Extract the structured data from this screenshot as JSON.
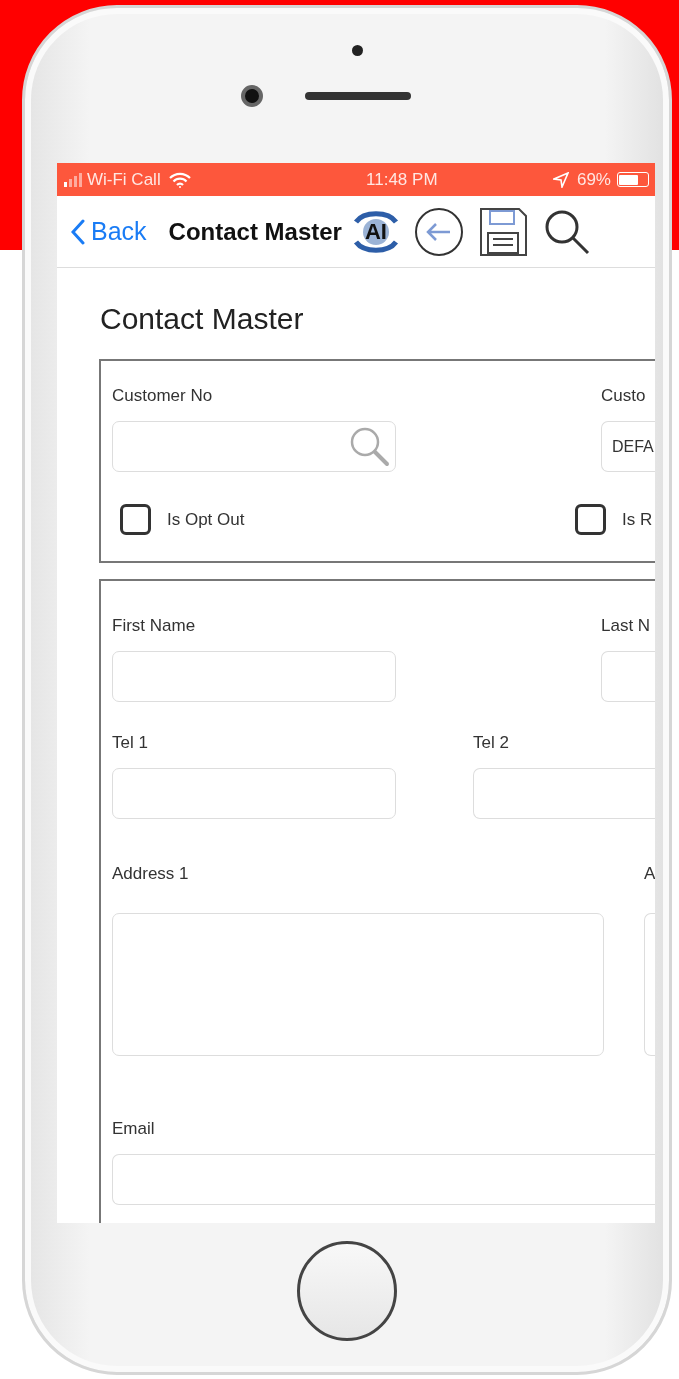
{
  "status_bar": {
    "carrier": "Wi-Fi Call",
    "time": "11:48 PM",
    "battery": "69%"
  },
  "nav_bar": {
    "back": "Back",
    "title": "Contact Master",
    "logo_text": "AI"
  },
  "page_title": "Contact Master",
  "sections": [
    {
      "rows": [
        {
          "fields": [
            {
              "label": "Customer No",
              "kind": "lookup"
            },
            {
              "label": "Custo",
              "kind": "text",
              "value": "DEFA"
            }
          ]
        },
        {
          "fields": [
            {
              "label": "Is Opt Out",
              "kind": "checkbox",
              "checked": false
            },
            {
              "label": "Is R",
              "kind": "checkbox",
              "checked": false
            }
          ]
        }
      ]
    },
    {
      "rows": [
        {
          "fields": [
            {
              "label": "First Name",
              "kind": "text"
            },
            {
              "label": "Last N",
              "kind": "text"
            }
          ]
        },
        {
          "fields": [
            {
              "label": "Tel 1",
              "kind": "text"
            },
            {
              "label": "Tel 2",
              "kind": "text"
            }
          ]
        },
        {
          "fields": [
            {
              "label": "Address 1",
              "kind": "textarea"
            },
            {
              "label": "A",
              "kind": "textarea"
            }
          ]
        },
        {
          "fields": [
            {
              "label": "Email",
              "kind": "text"
            }
          ]
        }
      ]
    }
  ]
}
